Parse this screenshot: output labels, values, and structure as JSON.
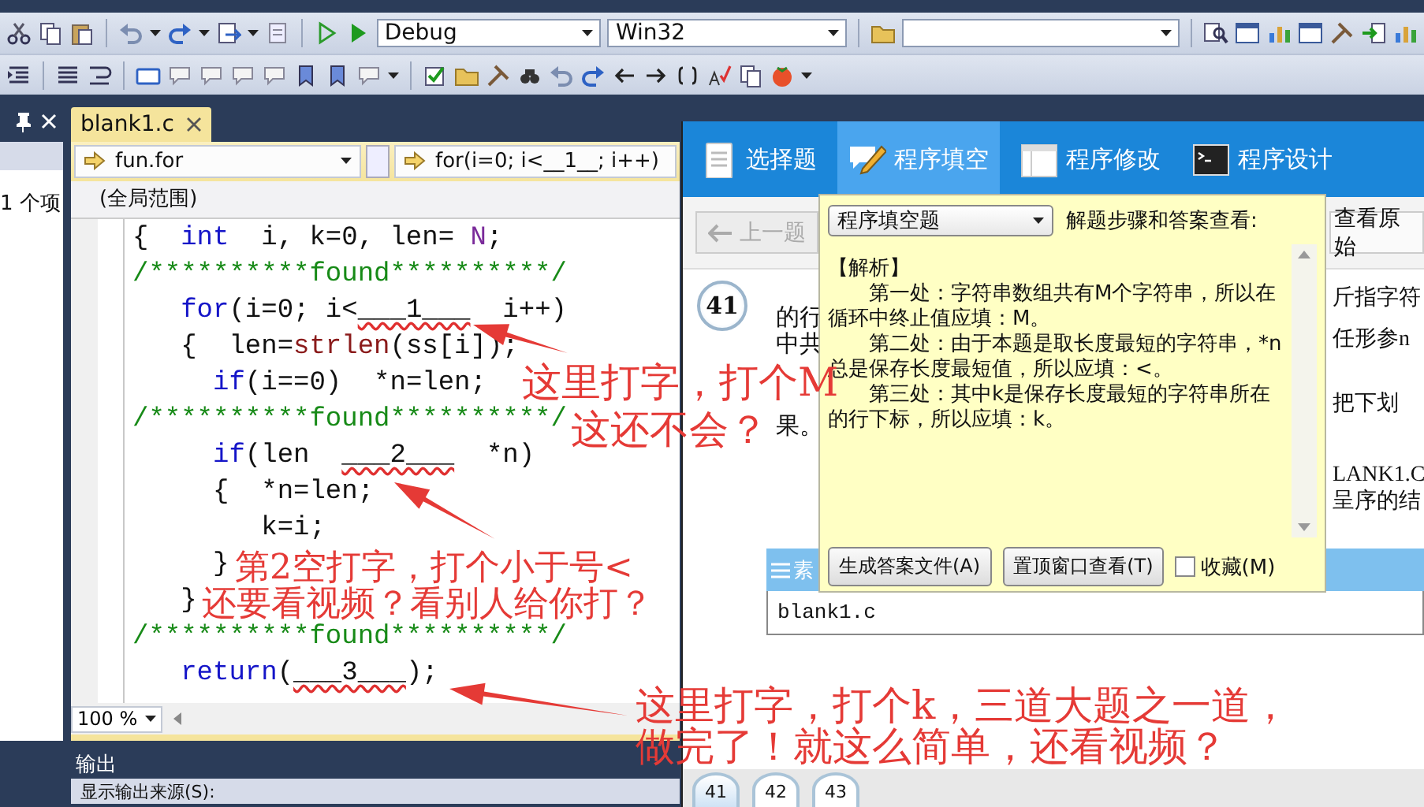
{
  "toolbar": {
    "configuration_combo": "Debug",
    "platform_combo": "Win32"
  },
  "solution_panel": {
    "item_count": "1 个项"
  },
  "editor": {
    "tabs": [
      {
        "label": "blank1.c",
        "selected": true
      }
    ],
    "function_combo": "fun.for",
    "member_combo": "for(i=0; i<__1__; i++)",
    "scope": "(全局范围)",
    "lines": [
      {
        "tokens": [
          {
            "text": "{  ",
            "kind": "plain"
          },
          {
            "text": "int",
            "kind": "keyword"
          },
          {
            "text": "  i, k=0, len= ",
            "kind": "plain"
          },
          {
            "text": "N",
            "kind": "macro"
          },
          {
            "text": ";",
            "kind": "plain"
          }
        ]
      },
      {
        "tokens": [
          {
            "text": "/**********found**********/",
            "kind": "comment"
          }
        ]
      },
      {
        "tokens": [
          {
            "text": "   for",
            "kind": "keyword"
          },
          {
            "text": "(i=0; i<",
            "kind": "plain"
          },
          {
            "text": "___1___",
            "kind": "blank"
          },
          {
            "text": "  i++)",
            "kind": "plain"
          }
        ]
      },
      {
        "tokens": [
          {
            "text": "   {  len=",
            "kind": "plain"
          },
          {
            "text": "strlen",
            "kind": "function"
          },
          {
            "text": "(ss[i]);",
            "kind": "plain"
          }
        ]
      },
      {
        "tokens": [
          {
            "text": "     if",
            "kind": "keyword"
          },
          {
            "text": "(i==0)  *n=len;",
            "kind": "plain"
          }
        ]
      },
      {
        "tokens": [
          {
            "text": "/**********found**********/",
            "kind": "comment"
          }
        ]
      },
      {
        "tokens": [
          {
            "text": "     if",
            "kind": "keyword"
          },
          {
            "text": "(len  ",
            "kind": "plain"
          },
          {
            "text": "___2___",
            "kind": "blank"
          },
          {
            "text": "  *n)",
            "kind": "plain"
          }
        ]
      },
      {
        "tokens": [
          {
            "text": "     {  *n=len;",
            "kind": "plain"
          }
        ]
      },
      {
        "tokens": [
          {
            "text": "        k=i;",
            "kind": "plain"
          }
        ]
      },
      {
        "tokens": [
          {
            "text": "     }",
            "kind": "plain"
          }
        ]
      },
      {
        "tokens": [
          {
            "text": "   }",
            "kind": "plain"
          }
        ]
      },
      {
        "tokens": [
          {
            "text": "/**********found**********/",
            "kind": "comment"
          }
        ]
      },
      {
        "tokens": [
          {
            "text": "   return",
            "kind": "keyword"
          },
          {
            "text": "(",
            "kind": "plain"
          },
          {
            "text": "___3___",
            "kind": "blank"
          },
          {
            "text": ");",
            "kind": "plain"
          }
        ]
      }
    ],
    "zoom": "100 %"
  },
  "output_panel": {
    "title": "输出",
    "source_label": "显示输出来源(S):"
  },
  "exam_app": {
    "tabs": [
      {
        "label": "选择题",
        "kind": "document",
        "selected": false
      },
      {
        "label": "程序填空",
        "kind": "pencil",
        "selected": true
      },
      {
        "label": "程序修改",
        "kind": "window",
        "selected": false
      },
      {
        "label": "程序设计",
        "kind": "terminal",
        "selected": false
      }
    ],
    "prev_button": "上一题",
    "view_original_button": "查看原始",
    "question_number": "41",
    "question_text_left": [
      "的行",
      "中共",
      "果。"
    ],
    "question_text_right": [
      "斤指字符",
      "任形参n",
      "把下划",
      "LANK1.C",
      "呈序的结"
    ],
    "section_bar": "素",
    "file_name": "blank1.c",
    "question_nav": [
      {
        "label": "41",
        "selected": true
      },
      {
        "label": "42",
        "selected": false
      },
      {
        "label": "43",
        "selected": false
      }
    ]
  },
  "answer_popup": {
    "type_combo": "程序填空题",
    "label": "解题步骤和答案查看:",
    "analysis_title": "【解析】",
    "analysis_paragraphs": [
      "第一处：字符串数组共有M个字符串，所以在循环中终止值应填：M。",
      "第二处：由于本题是取长度最短的字符串，*n总是保存长度最短值，所以应填：<。",
      "第三处：其中k是保存长度最短的字符串所在的行下标，所以应填：k。"
    ],
    "buttons": [
      "生成答案文件(A)",
      "置顶窗口查看(T)"
    ],
    "favorite": {
      "label": "收藏(M)",
      "checked": false
    }
  },
  "annotations": [
    {
      "text": "这里打字，打个M"
    },
    {
      "text": "这还不会？"
    },
    {
      "text": "第2空打字，打个小于号<"
    },
    {
      "text": "还要看视频？看别人给你打？"
    },
    {
      "text": "这里打字，打个k，三道大题之一道，"
    },
    {
      "text": "做完了！就这么简单，还看视频？"
    }
  ]
}
